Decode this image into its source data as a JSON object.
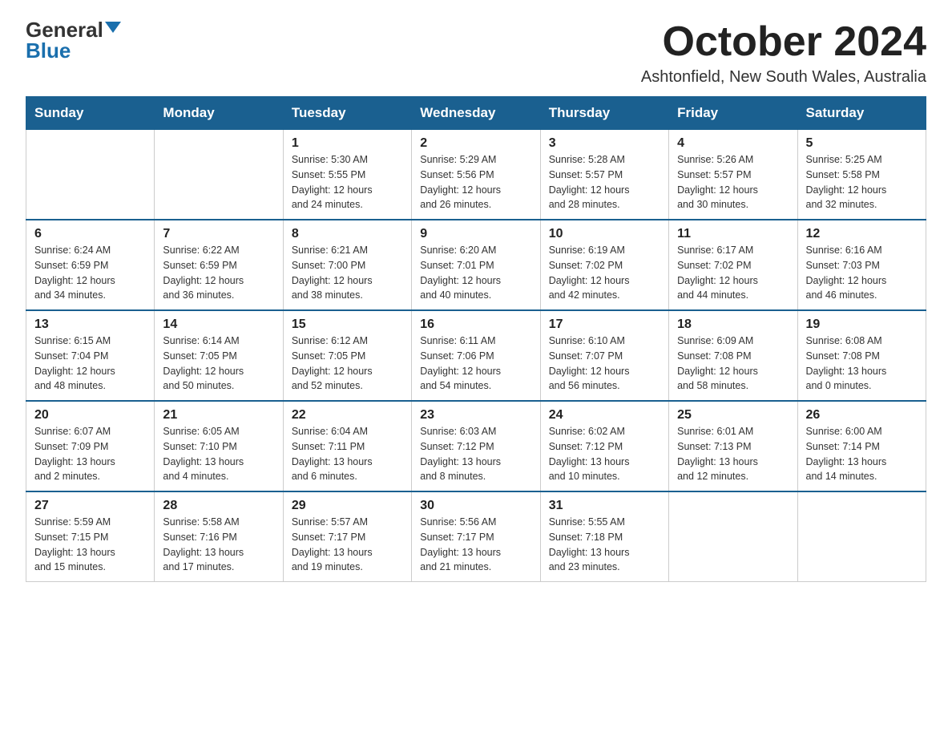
{
  "header": {
    "logo_general": "General",
    "logo_blue": "Blue",
    "month": "October 2024",
    "location": "Ashtonfield, New South Wales, Australia"
  },
  "weekdays": [
    "Sunday",
    "Monday",
    "Tuesday",
    "Wednesday",
    "Thursday",
    "Friday",
    "Saturday"
  ],
  "weeks": [
    [
      {
        "day": "",
        "info": ""
      },
      {
        "day": "",
        "info": ""
      },
      {
        "day": "1",
        "info": "Sunrise: 5:30 AM\nSunset: 5:55 PM\nDaylight: 12 hours\nand 24 minutes."
      },
      {
        "day": "2",
        "info": "Sunrise: 5:29 AM\nSunset: 5:56 PM\nDaylight: 12 hours\nand 26 minutes."
      },
      {
        "day": "3",
        "info": "Sunrise: 5:28 AM\nSunset: 5:57 PM\nDaylight: 12 hours\nand 28 minutes."
      },
      {
        "day": "4",
        "info": "Sunrise: 5:26 AM\nSunset: 5:57 PM\nDaylight: 12 hours\nand 30 minutes."
      },
      {
        "day": "5",
        "info": "Sunrise: 5:25 AM\nSunset: 5:58 PM\nDaylight: 12 hours\nand 32 minutes."
      }
    ],
    [
      {
        "day": "6",
        "info": "Sunrise: 6:24 AM\nSunset: 6:59 PM\nDaylight: 12 hours\nand 34 minutes."
      },
      {
        "day": "7",
        "info": "Sunrise: 6:22 AM\nSunset: 6:59 PM\nDaylight: 12 hours\nand 36 minutes."
      },
      {
        "day": "8",
        "info": "Sunrise: 6:21 AM\nSunset: 7:00 PM\nDaylight: 12 hours\nand 38 minutes."
      },
      {
        "day": "9",
        "info": "Sunrise: 6:20 AM\nSunset: 7:01 PM\nDaylight: 12 hours\nand 40 minutes."
      },
      {
        "day": "10",
        "info": "Sunrise: 6:19 AM\nSunset: 7:02 PM\nDaylight: 12 hours\nand 42 minutes."
      },
      {
        "day": "11",
        "info": "Sunrise: 6:17 AM\nSunset: 7:02 PM\nDaylight: 12 hours\nand 44 minutes."
      },
      {
        "day": "12",
        "info": "Sunrise: 6:16 AM\nSunset: 7:03 PM\nDaylight: 12 hours\nand 46 minutes."
      }
    ],
    [
      {
        "day": "13",
        "info": "Sunrise: 6:15 AM\nSunset: 7:04 PM\nDaylight: 12 hours\nand 48 minutes."
      },
      {
        "day": "14",
        "info": "Sunrise: 6:14 AM\nSunset: 7:05 PM\nDaylight: 12 hours\nand 50 minutes."
      },
      {
        "day": "15",
        "info": "Sunrise: 6:12 AM\nSunset: 7:05 PM\nDaylight: 12 hours\nand 52 minutes."
      },
      {
        "day": "16",
        "info": "Sunrise: 6:11 AM\nSunset: 7:06 PM\nDaylight: 12 hours\nand 54 minutes."
      },
      {
        "day": "17",
        "info": "Sunrise: 6:10 AM\nSunset: 7:07 PM\nDaylight: 12 hours\nand 56 minutes."
      },
      {
        "day": "18",
        "info": "Sunrise: 6:09 AM\nSunset: 7:08 PM\nDaylight: 12 hours\nand 58 minutes."
      },
      {
        "day": "19",
        "info": "Sunrise: 6:08 AM\nSunset: 7:08 PM\nDaylight: 13 hours\nand 0 minutes."
      }
    ],
    [
      {
        "day": "20",
        "info": "Sunrise: 6:07 AM\nSunset: 7:09 PM\nDaylight: 13 hours\nand 2 minutes."
      },
      {
        "day": "21",
        "info": "Sunrise: 6:05 AM\nSunset: 7:10 PM\nDaylight: 13 hours\nand 4 minutes."
      },
      {
        "day": "22",
        "info": "Sunrise: 6:04 AM\nSunset: 7:11 PM\nDaylight: 13 hours\nand 6 minutes."
      },
      {
        "day": "23",
        "info": "Sunrise: 6:03 AM\nSunset: 7:12 PM\nDaylight: 13 hours\nand 8 minutes."
      },
      {
        "day": "24",
        "info": "Sunrise: 6:02 AM\nSunset: 7:12 PM\nDaylight: 13 hours\nand 10 minutes."
      },
      {
        "day": "25",
        "info": "Sunrise: 6:01 AM\nSunset: 7:13 PM\nDaylight: 13 hours\nand 12 minutes."
      },
      {
        "day": "26",
        "info": "Sunrise: 6:00 AM\nSunset: 7:14 PM\nDaylight: 13 hours\nand 14 minutes."
      }
    ],
    [
      {
        "day": "27",
        "info": "Sunrise: 5:59 AM\nSunset: 7:15 PM\nDaylight: 13 hours\nand 15 minutes."
      },
      {
        "day": "28",
        "info": "Sunrise: 5:58 AM\nSunset: 7:16 PM\nDaylight: 13 hours\nand 17 minutes."
      },
      {
        "day": "29",
        "info": "Sunrise: 5:57 AM\nSunset: 7:17 PM\nDaylight: 13 hours\nand 19 minutes."
      },
      {
        "day": "30",
        "info": "Sunrise: 5:56 AM\nSunset: 7:17 PM\nDaylight: 13 hours\nand 21 minutes."
      },
      {
        "day": "31",
        "info": "Sunrise: 5:55 AM\nSunset: 7:18 PM\nDaylight: 13 hours\nand 23 minutes."
      },
      {
        "day": "",
        "info": ""
      },
      {
        "day": "",
        "info": ""
      }
    ]
  ]
}
